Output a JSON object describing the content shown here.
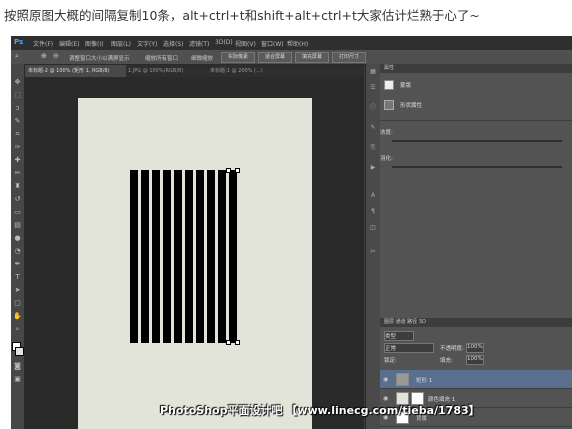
{
  "caption": "按照原图大概的间隔复制10条，alt+ctrl+t和shift+alt+ctrl+t大家估计烂熟于心了~",
  "app": {
    "logo": "Ps",
    "menu": [
      "文件(F)",
      "编辑(E)",
      "图像(I)",
      "图层(L)",
      "文字(Y)",
      "选择(S)",
      "滤镜(T)",
      "3D(D)",
      "视图(V)",
      "窗口(W)",
      "帮助(H)"
    ]
  },
  "options": {
    "zoom_label": "100%",
    "check1": "调整窗口大小以满屏显示",
    "check2": "缩放所有窗口",
    "check3": "细微缩放",
    "btn_actual": "实际像素",
    "btn_fit": "适合屏幕",
    "btn_fill": "填充屏幕",
    "btn_print": "打印尺寸"
  },
  "tabs": [
    "未标题-2 @ 100% (矩形 1, RGB/8)",
    "1.JPG @ 100%(RGB/8)",
    "未标题-1 @ 200% (...)"
  ],
  "canvas": {
    "background": "#e2e4d9",
    "stripe_count": 10,
    "stripe_color": "#000000"
  },
  "properties": {
    "header": "属性",
    "mask_label": "蒙版",
    "shape_label": "形状属性",
    "density_label": "浓度:",
    "feather_label": "羽化:"
  },
  "layers_panel": {
    "tabs": "图层  通道  路径  3D",
    "kind": "类型",
    "blend": "正常",
    "opacity_label": "不透明度:",
    "opacity": "100%",
    "lock_label": "锁定:",
    "fill_label": "填充:",
    "fill": "100%",
    "layers": [
      {
        "name": "矩形 1",
        "selected": true
      },
      {
        "name": "颜色填充 1",
        "selected": false
      },
      {
        "name": "背景",
        "selected": false
      }
    ]
  },
  "watermark": "PhotoShop平面设计吧 【www.linecg.com/tieba/1783】"
}
